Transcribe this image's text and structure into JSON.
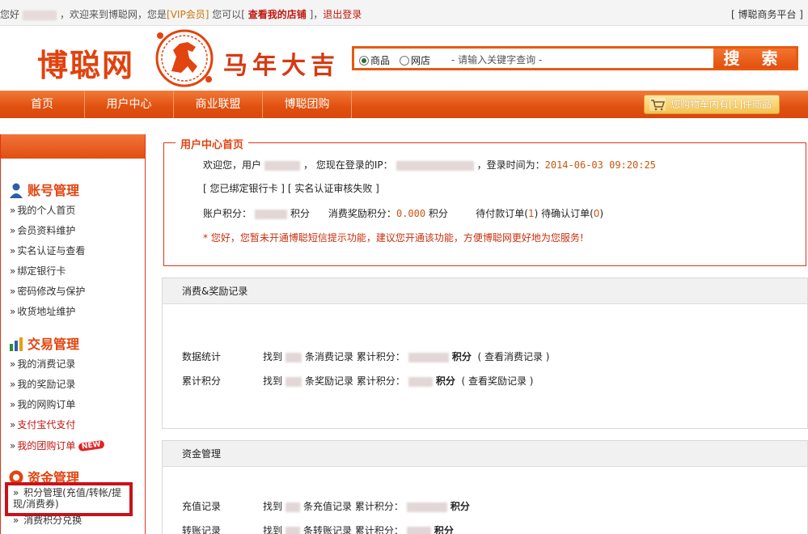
{
  "topbar": {
    "greeting_prefix": "您好",
    "welcome": "，欢迎来到博聪网，您是",
    "vip": "[VIP会员]",
    "can": "您可以[",
    "view_shop": "查看我的店铺",
    "sep": "]，",
    "logout": "退出登录",
    "right": "[ 博聪商务平台 ]"
  },
  "header": {
    "logo": "博聪网",
    "slogan": "马年大吉"
  },
  "search": {
    "option_goods": "商品",
    "option_shop": "网店",
    "placeholder": "- 请输入关键字查询 -",
    "button": "搜 索"
  },
  "nav": {
    "items": [
      "首页",
      "用户中心",
      "商业联盟",
      "博聪团购"
    ],
    "cart": "您购物车内有[1]件商品"
  },
  "sidebar": {
    "account_title": "账号管理",
    "account_links": [
      "我的个人首页",
      "会员资料维护",
      "实名认证与查看",
      "绑定银行卡",
      "密码修改与保护",
      "收货地址维护"
    ],
    "trade_title": "交易管理",
    "trade_links": [
      "我的消费记录",
      "我的奖励记录",
      "我的网购订单"
    ],
    "trade_red_links": [
      "支付宝代支付",
      "我的团购订单"
    ],
    "new_badge": "NEW",
    "fund_title": "资金管理",
    "fund_links": [
      "积分管理(充值/转帐/提现/消费券)",
      "消费积分兑换"
    ]
  },
  "welcome": {
    "legend": "用户中心首页",
    "line1_a": "欢迎您，用户",
    "line1_b": "，  您现在登录的IP：",
    "line1_c": "，登录时间为：",
    "login_time": "2014-06-03 09:20:25",
    "bank": "[ 您已绑定银行卡 ]",
    "realname": "[ 实名认证审核失败 ]",
    "points_label": "账户积分：",
    "points_unit": "积分",
    "reward_label": "消费奖励积分：",
    "reward_value": "0.000",
    "reward_unit": "积分",
    "pending_pay": "待付款订单(",
    "pending_pay_n": "1",
    "pending_confirm": ")  待确认订单(",
    "pending_confirm_n": "0",
    "close_paren": ")",
    "notice": "您好，您暂未开通博聪短信提示功能，建议您开通该功能，方便博聪网更好地为您服务!"
  },
  "consume_panel": {
    "title": "消费&奖励记录",
    "row1_label": "数据统计",
    "row1_a": "找到",
    "row1_b": "条消费记录  累计积分：",
    "row1_unit": "积分",
    "row1_link": "( 查看消费记录 )",
    "row2_label": "累计积分",
    "row2_a": "找到",
    "row2_b": "条奖励记录  累计积分：",
    "row2_unit": "积分",
    "row2_link": "( 查看奖励记录 )"
  },
  "fund_panel": {
    "title": "资金管理",
    "row1_label": "充值记录",
    "row1_a": "找到",
    "row1_b": "条充值记录  累计积分：",
    "row1_unit": "积分",
    "row2_label": "转账记录",
    "row2_a": "找到",
    "row2_b": "条转账记录  累计积分：",
    "row2_unit": "积分"
  },
  "colors": {
    "brand_orange": "#e2440f",
    "nav_orange": "#e0500f",
    "link_red": "#c0160f"
  }
}
